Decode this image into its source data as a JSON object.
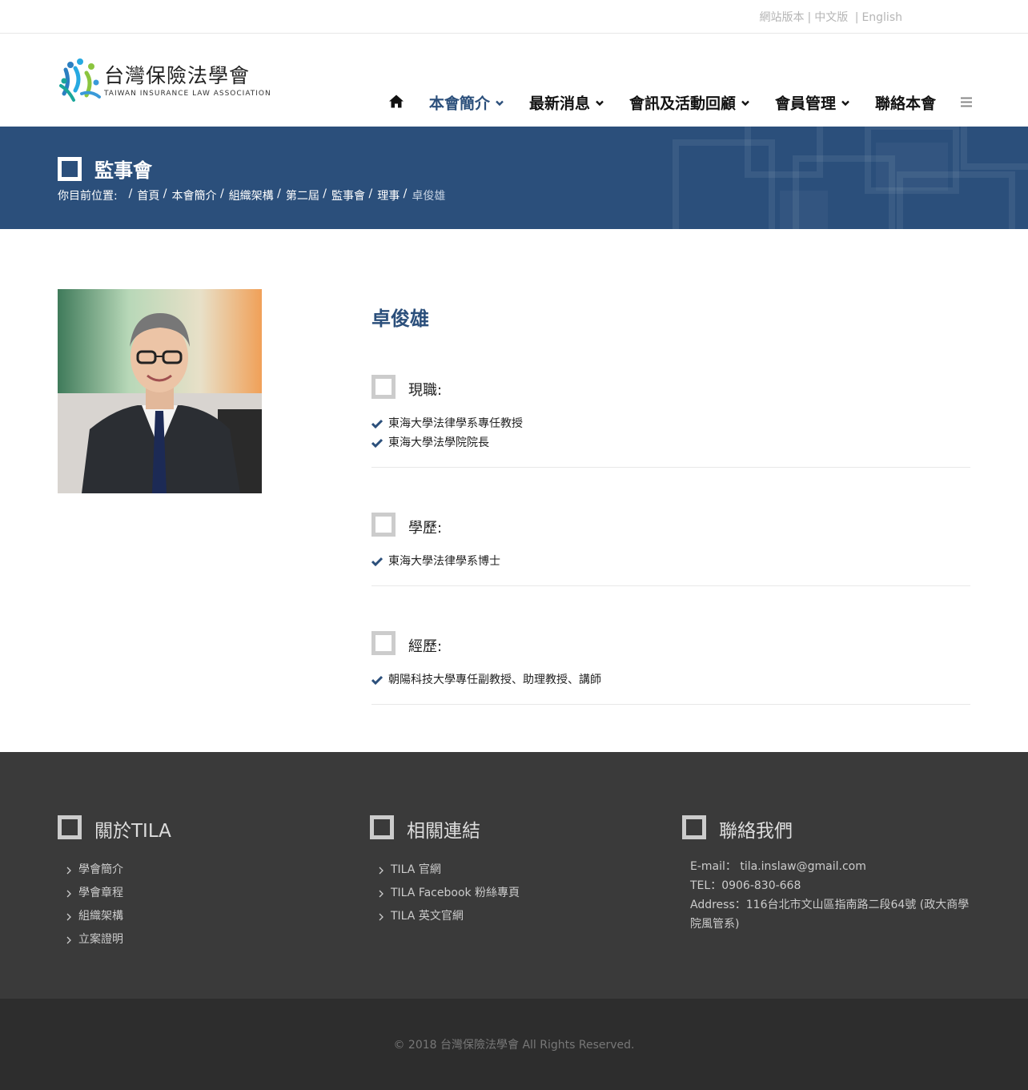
{
  "topbar": {
    "links": [
      "網站版本",
      "中文版",
      "English"
    ]
  },
  "logo": {
    "name_zh": "台灣保險法學會",
    "name_en": "TAIWAN INSURANCE LAW ASSOCIATION"
  },
  "nav": {
    "items": [
      {
        "label": "本會簡介",
        "active": true
      },
      {
        "label": "最新消息",
        "active": false
      },
      {
        "label": "會訊及活動回顧",
        "active": false
      },
      {
        "label": "會員管理",
        "active": false
      },
      {
        "label": "聯絡本會",
        "active": false
      }
    ]
  },
  "band": {
    "title": "監事會",
    "breadcrumb_prefix": "你目前位置:",
    "breadcrumb": [
      "首頁",
      "本會簡介",
      "組織架構",
      "第二屆",
      "監事會",
      "理事",
      "卓俊雄"
    ]
  },
  "profile": {
    "name": "卓俊雄",
    "sections": [
      {
        "title": "現職:",
        "items": [
          "東海大學法律學系專任教授",
          "東海大學法學院院長"
        ]
      },
      {
        "title": "學歷:",
        "items": [
          "東海大學法律學系博士"
        ]
      },
      {
        "title": "經歷:",
        "items": [
          "朝陽科技大學專任副教授、助理教授、講師"
        ]
      }
    ]
  },
  "footer": {
    "about": {
      "title": "關於TILA",
      "links": [
        "學會簡介",
        "學會章程",
        "組織架構",
        "立案證明"
      ]
    },
    "related": {
      "title": "相關連結",
      "links": [
        "TILA 官網",
        "TILA Facebook 粉絲專頁",
        "TILA 英文官網"
      ]
    },
    "contact": {
      "title": "聯絡我們",
      "email": "E-mail： tila.inslaw@gmail.com",
      "tel": "TEL：0906-830-668",
      "address": "Address：116台北市文山區指南路二段64號 (政大商學院風管系)"
    },
    "copyright": "© 2018 台灣保險法學會 All Rights Reserved."
  },
  "colors": {
    "brand": "#2b4f7b",
    "footer_bg": "#3a3a3a",
    "copy_bg": "#2d2d2d"
  }
}
